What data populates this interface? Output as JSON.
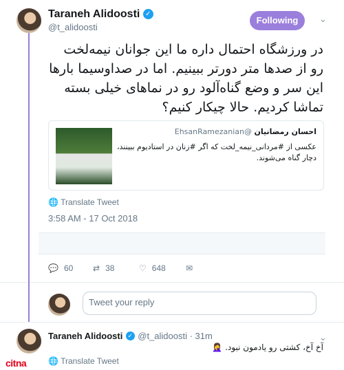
{
  "tweet": {
    "author_name": "Taraneh Alidoosti",
    "author_handle": "@t_alidoosti",
    "follow_label": "Following",
    "text": "در ورزشگاه احتمال داره ما این جوانان نیمه‌لخت رو از صدها متر دورتر ببینیم. اما در صداوسیما بارها این سر و وضع گناه‌آلود رو در نماهای خیلی بسته تماشا کردیم. حالا چیکار کنیم؟",
    "quote": {
      "author_name": "احسان رمضانیان",
      "author_handle": "@EhsanRamezanian",
      "text": "عکسی از #مردانی_نیمه_لخت که اگر #زنان در استادیوم ببینند، دچار گناه می‌شوند."
    },
    "translate_label": "Translate Tweet",
    "timestamp": "3:58 AM - 17 Oct 2018",
    "replies": "60",
    "retweets": "38",
    "likes": "648",
    "reply_placeholder": "Tweet your reply"
  },
  "reply": {
    "author_name": "Taraneh Alidoosti",
    "handle_time": "@t_alidoosti · 31m",
    "text": "آخ آخ، کشتی رو یادمون نبود.",
    "emoji": "🤦‍♀️",
    "translate_label": "Translate Tweet"
  },
  "watermark": {
    "logo_text": "citna"
  },
  "colors": {
    "accent": "#9b7fdc",
    "verified": "#1da1f2",
    "logo": "#e0001b"
  }
}
